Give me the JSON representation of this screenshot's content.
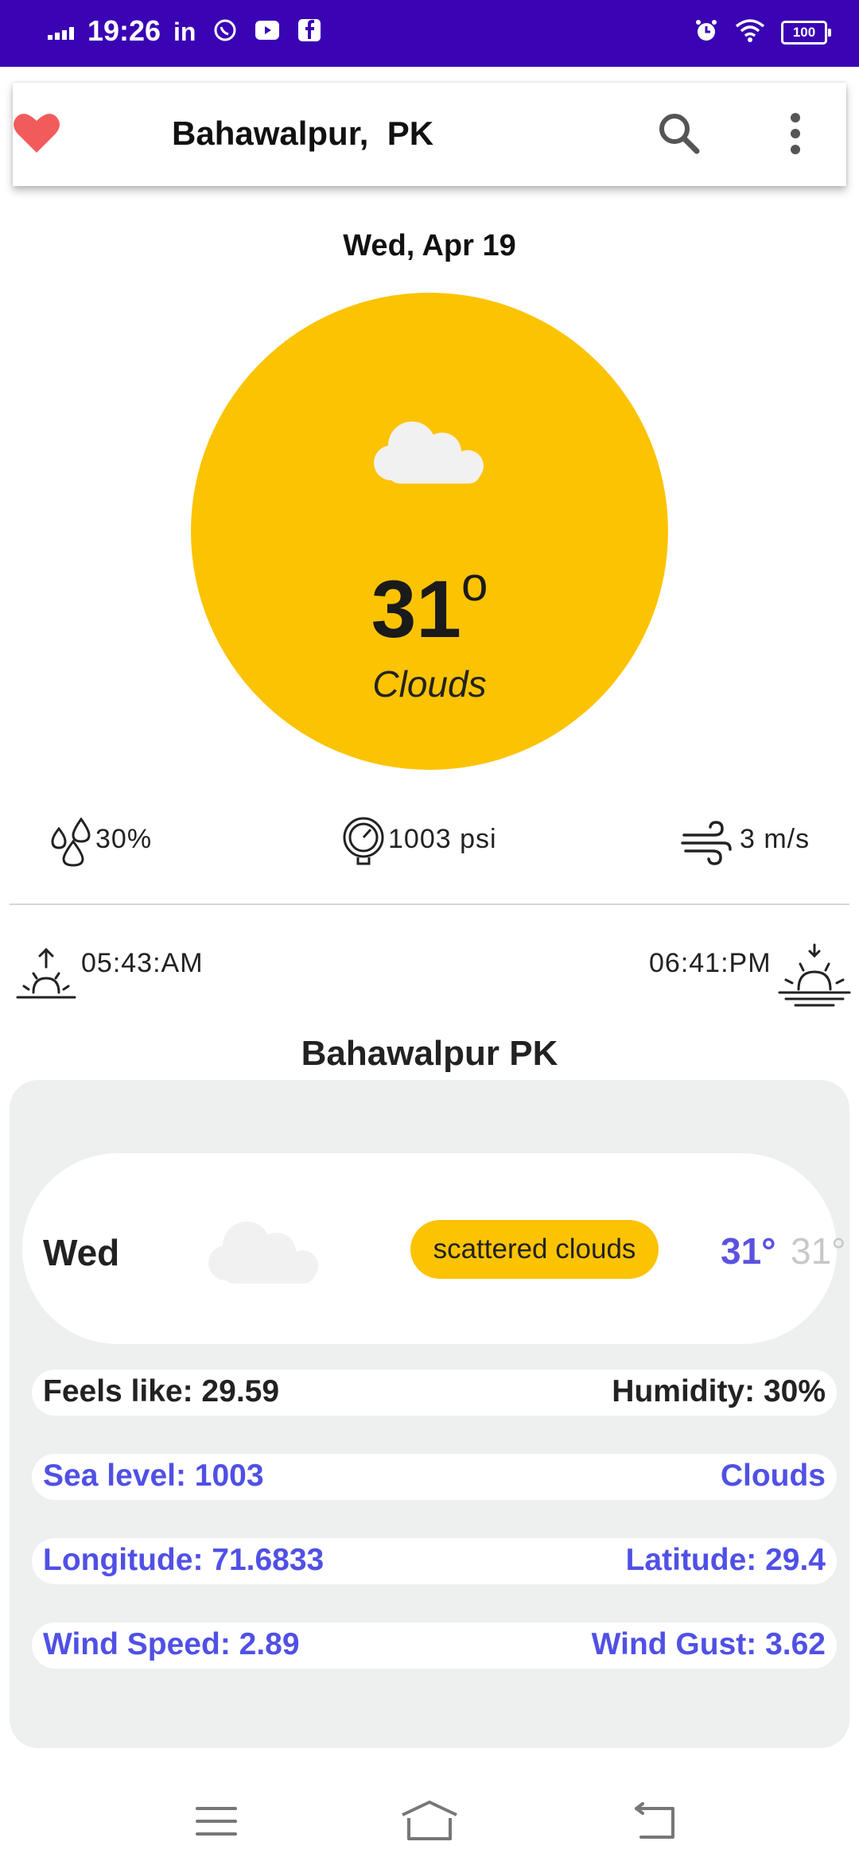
{
  "status_bar": {
    "time": "19:26",
    "battery": "100",
    "left_icons": [
      "signal-icon",
      "linkedin-icon",
      "whatsapp-icon",
      "youtube-icon",
      "facebook-icon"
    ],
    "right_icons": [
      "alarm-icon",
      "wifi-icon",
      "battery-icon"
    ]
  },
  "app_bar": {
    "title": "Bahawalpur,  PK",
    "icons": [
      "heart-icon",
      "search-icon",
      "more-vert-icon"
    ],
    "heart_color": "#f15b5b"
  },
  "current": {
    "date": "Wed, Apr 19",
    "temp": "31",
    "degree": "o",
    "condition": "Clouds",
    "icon": "cloud-icon",
    "circle_color": "#fcc302"
  },
  "stats": {
    "humidity": "30%",
    "pressure": "1003 psi",
    "wind": "3 m/s"
  },
  "sun": {
    "sunrise": "05:43:AM",
    "sunset": "06:41:PM"
  },
  "details": {
    "title": "Bahawalpur PK",
    "forecast": {
      "day": "Wed",
      "description": "scattered clouds",
      "high": "31°",
      "low": "31°"
    },
    "rows": [
      {
        "left": "Feels like: 29.59",
        "right": "Humidity: 30%"
      },
      {
        "left": "Sea level: 1003",
        "right": "Clouds"
      },
      {
        "left": "Longitude: 71.6833",
        "right": "Latitude: 29.4"
      },
      {
        "left": "Wind Speed: 2.89",
        "right": "Wind Gust: 3.62"
      }
    ]
  },
  "colors": {
    "status_bar": "#3a03b4",
    "accent": "#fcc302",
    "blue_text": "#5050e6",
    "panel": "#eeefef"
  }
}
